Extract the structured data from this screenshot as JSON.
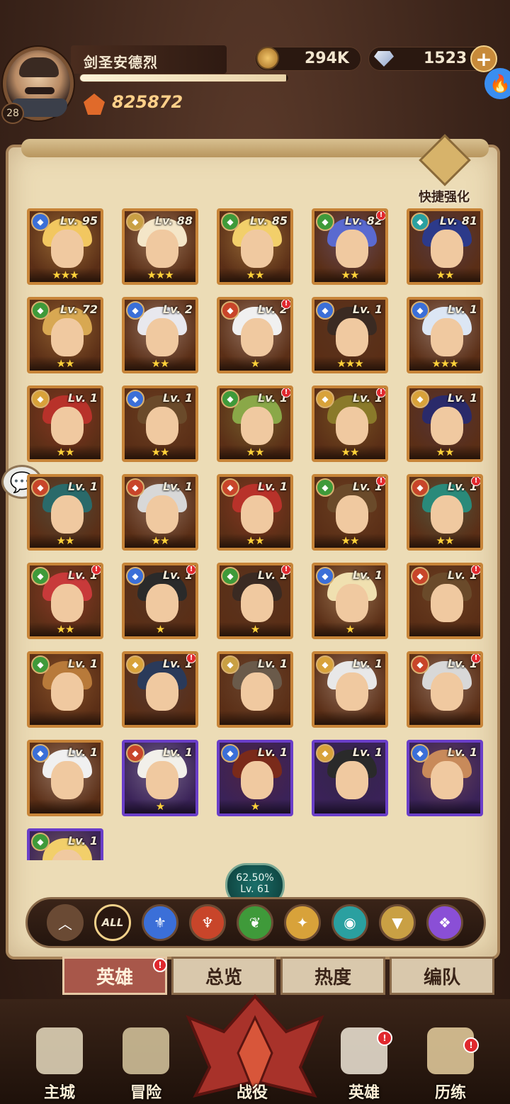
{
  "player": {
    "name": "剑圣安德烈",
    "level": "28",
    "power": "825872",
    "exp_fraction": 0.99
  },
  "resources": {
    "gold": "294K",
    "gems": "1523",
    "plus_label": "+"
  },
  "quick_enhance_label": "快捷强化",
  "collection": {
    "percent": "62.50%",
    "level": "Lv. 61"
  },
  "faction_colors": {
    "water": "#3b6fd8",
    "fire": "#c8452a",
    "nature": "#3f9a3a",
    "light": "#d8a23a",
    "spirit": "#2aa0a0",
    "holy": "#c9a044",
    "chaos": "#8a4fd6"
  },
  "heroes": [
    {
      "level": "Lv. 95",
      "stars": "★★★",
      "faction": "water",
      "hair": "#f2c760",
      "alert": false,
      "frame": "gold"
    },
    {
      "level": "Lv. 88",
      "stars": "★★★",
      "faction": "holy",
      "hair": "#f4e6c8",
      "alert": false,
      "frame": "gold"
    },
    {
      "level": "Lv. 85",
      "stars": "★★",
      "faction": "nature",
      "hair": "#f2cf6a",
      "alert": false,
      "frame": "gold"
    },
    {
      "level": "Lv. 82",
      "stars": "★★",
      "faction": "nature",
      "hair": "#5a6ad0",
      "alert": true,
      "frame": "gold"
    },
    {
      "level": "Lv. 81",
      "stars": "★★",
      "faction": "spirit",
      "hair": "#2c3a8a",
      "alert": false,
      "frame": "gold"
    },
    {
      "level": "Lv. 72",
      "stars": "★★",
      "faction": "nature",
      "hair": "#d8a852",
      "alert": false,
      "frame": "gold"
    },
    {
      "level": "Lv. 2",
      "stars": "★★",
      "faction": "water",
      "hair": "#e8e8ee",
      "alert": false,
      "frame": "gold"
    },
    {
      "level": "Lv. 2",
      "stars": "★",
      "faction": "fire",
      "hair": "#f0f0f0",
      "alert": true,
      "frame": "gold"
    },
    {
      "level": "Lv. 1",
      "stars": "★★★",
      "faction": "water",
      "hair": "#3a2a22",
      "alert": false,
      "frame": "gold"
    },
    {
      "level": "Lv. 1",
      "stars": "★★★",
      "faction": "water",
      "hair": "#dce6f4",
      "alert": false,
      "frame": "gold"
    },
    {
      "level": "Lv. 1",
      "stars": "★★",
      "faction": "light",
      "hair": "#b8322a",
      "alert": false,
      "frame": "gold"
    },
    {
      "level": "Lv. 1",
      "stars": "★★",
      "faction": "water",
      "hair": "#6a4a2a",
      "alert": false,
      "frame": "gold"
    },
    {
      "level": "Lv. 1",
      "stars": "★★",
      "faction": "nature",
      "hair": "#8aa848",
      "alert": true,
      "frame": "gold"
    },
    {
      "level": "Lv. 1",
      "stars": "★★",
      "faction": "light",
      "hair": "#8a7a2a",
      "alert": true,
      "frame": "gold"
    },
    {
      "level": "Lv. 1",
      "stars": "★★",
      "faction": "light",
      "hair": "#2a2a6a",
      "alert": false,
      "frame": "gold"
    },
    {
      "level": "Lv. 1",
      "stars": "★★",
      "faction": "fire",
      "hair": "#2a6a6a",
      "alert": false,
      "frame": "gold"
    },
    {
      "level": "Lv. 1",
      "stars": "★★",
      "faction": "fire",
      "hair": "#d8d8d8",
      "alert": false,
      "frame": "gold"
    },
    {
      "level": "Lv. 1",
      "stars": "★★",
      "faction": "fire",
      "hair": "#b8322a",
      "alert": false,
      "frame": "gold"
    },
    {
      "level": "Lv. 1",
      "stars": "★★",
      "faction": "nature",
      "hair": "#6a4a2a",
      "alert": true,
      "frame": "gold"
    },
    {
      "level": "Lv. 1",
      "stars": "★★",
      "faction": "fire",
      "hair": "#2a8a7a",
      "alert": true,
      "frame": "gold"
    },
    {
      "level": "Lv. 1",
      "stars": "★★",
      "faction": "nature",
      "hair": "#c83a3a",
      "alert": true,
      "frame": "gold"
    },
    {
      "level": "Lv. 1",
      "stars": "★",
      "faction": "water",
      "hair": "#2a2a2a",
      "alert": true,
      "frame": "gold"
    },
    {
      "level": "Lv. 1",
      "stars": "★",
      "faction": "nature",
      "hair": "#3a2a22",
      "alert": true,
      "frame": "gold"
    },
    {
      "level": "Lv. 1",
      "stars": "★",
      "faction": "water",
      "hair": "#f0e0b0",
      "alert": false,
      "frame": "gold"
    },
    {
      "level": "Lv. 1",
      "stars": "",
      "faction": "fire",
      "hair": "#6a4a2a",
      "alert": true,
      "frame": "gold"
    },
    {
      "level": "Lv. 1",
      "stars": "",
      "faction": "nature",
      "hair": "#b87a3a",
      "alert": false,
      "frame": "gold"
    },
    {
      "level": "Lv. 1",
      "stars": "",
      "faction": "light",
      "hair": "#2a3a5a",
      "alert": true,
      "frame": "gold"
    },
    {
      "level": "Lv. 1",
      "stars": "",
      "faction": "holy",
      "hair": "#6a5a4a",
      "alert": false,
      "frame": "gold"
    },
    {
      "level": "Lv. 1",
      "stars": "",
      "faction": "light",
      "hair": "#e8e8e8",
      "alert": false,
      "frame": "gold"
    },
    {
      "level": "Lv. 1",
      "stars": "",
      "faction": "fire",
      "hair": "#d8d8d8",
      "alert": true,
      "frame": "gold"
    },
    {
      "level": "Lv. 1",
      "stars": "",
      "faction": "water",
      "hair": "#f0f0f0",
      "alert": false,
      "frame": "gold"
    },
    {
      "level": "Lv. 1",
      "stars": "★",
      "faction": "fire",
      "hair": "#f2f0ea",
      "alert": false,
      "frame": "purple"
    },
    {
      "level": "Lv. 1",
      "stars": "★",
      "faction": "water",
      "hair": "#7a2a1a",
      "alert": false,
      "frame": "purple"
    },
    {
      "level": "Lv. 1",
      "stars": "",
      "faction": "light",
      "hair": "#2a2a2a",
      "alert": false,
      "frame": "purple"
    },
    {
      "level": "Lv. 1",
      "stars": "",
      "faction": "water",
      "hair": "#c88a5a",
      "alert": false,
      "frame": "purple"
    },
    {
      "level": "Lv. 1",
      "stars": "",
      "faction": "nature",
      "hair": "#f2cf6a",
      "alert": false,
      "frame": "purple"
    }
  ],
  "filters": [
    {
      "id": "collapse",
      "label": "︿",
      "color": "#6a4a34"
    },
    {
      "id": "all",
      "label": "ALL",
      "color": "#2a1810"
    },
    {
      "id": "water",
      "label": "⚜",
      "color": "#3b6fd8"
    },
    {
      "id": "fire",
      "label": "♆",
      "color": "#c8452a"
    },
    {
      "id": "nature",
      "label": "❦",
      "color": "#3f9a3a"
    },
    {
      "id": "light",
      "label": "✦",
      "color": "#d8a23a"
    },
    {
      "id": "spirit",
      "label": "◉",
      "color": "#2aa0a0"
    },
    {
      "id": "holy",
      "label": "▼",
      "color": "#c9a044"
    },
    {
      "id": "chaos",
      "label": "❖",
      "color": "#8a4fd6"
    }
  ],
  "tabs": [
    "英雄",
    "总览",
    "热度",
    "编队"
  ],
  "nav": [
    {
      "label": "主城",
      "alert": false
    },
    {
      "label": "冒险",
      "alert": false
    },
    {
      "label": "战役",
      "alert": false
    },
    {
      "label": "英雄",
      "alert": true
    },
    {
      "label": "历练",
      "alert": true
    }
  ],
  "alert_mark": "!"
}
